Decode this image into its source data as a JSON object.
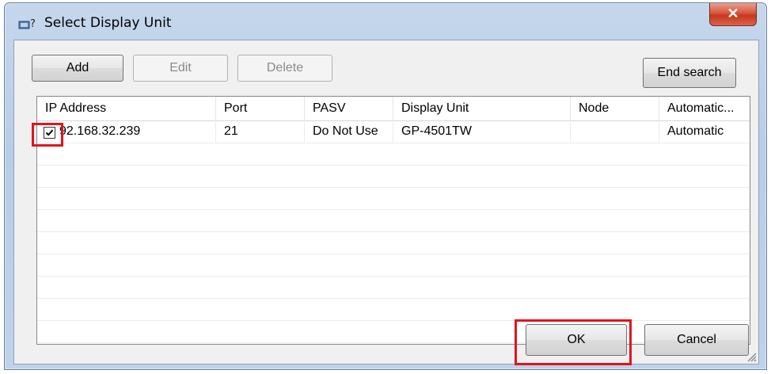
{
  "window": {
    "title": "Select Display Unit",
    "close_glyph": "✕"
  },
  "toolbar": {
    "add": "Add",
    "edit": "Edit",
    "delete": "Delete",
    "end_search": "End search"
  },
  "table": {
    "columns": [
      "IP Address",
      "Port",
      "PASV",
      "Display Unit",
      "Node",
      "Automatic..."
    ],
    "rows": [
      {
        "checked": true,
        "ip": "92.168.32.239",
        "port": "21",
        "pasv": "Do Not Use",
        "display_unit": "GP-4501TW",
        "node": "",
        "automatic": "Automatic"
      }
    ]
  },
  "footer": {
    "ok": "OK",
    "cancel": "Cancel"
  },
  "colors": {
    "highlight": "#e0151e",
    "close_button": "#c7381c"
  },
  "icons": [
    "display-unit-icon",
    "close-icon",
    "checkbox-checked-icon",
    "resize-grip-icon"
  ]
}
